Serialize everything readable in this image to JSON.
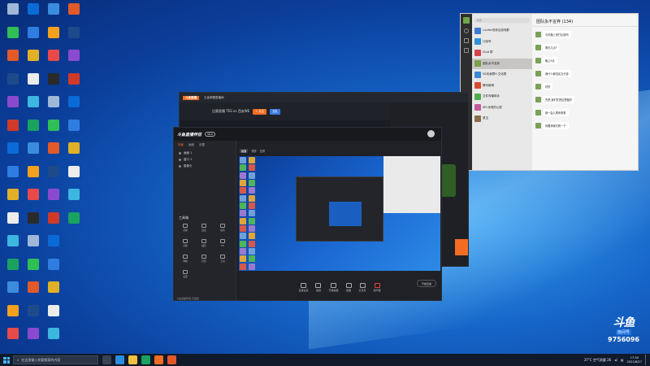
{
  "taskbar": {
    "search_placeholder": "在这里输入你要搜索的内容",
    "weather": "37°C 空气质量 26",
    "time": "17:30",
    "date": "2021/8/27"
  },
  "overlay": {
    "brand": "斗鱼",
    "room_label": "房间号",
    "room_number": "9756096"
  },
  "chat": {
    "title": "团队永不言弃 (134)",
    "search": "搜索",
    "contacts": [
      {
        "name": "Lucifer的综合游戏群",
        "color": "#3b7bd1"
      },
      {
        "name": "订阅号",
        "color": "#2f8fd8"
      },
      {
        "name": "Stud 群",
        "color": "#d5444a"
      },
      {
        "name": "团队永不言弃",
        "color": "#7b9f4a"
      },
      {
        "name": "N2玩家群5-文化群",
        "color": "#3d89d4"
      },
      {
        "name": "腾讯新闻",
        "color": "#d84a31"
      },
      {
        "name": "文件传输助手",
        "color": "#4fae4f"
      },
      {
        "name": "KPL永恒的心愿",
        "color": "#c45b9a"
      },
      {
        "name": "泉玉",
        "color": "#8a6d4c"
      }
    ],
    "messages": [
      "今天晚上来打比赛吗",
      "明天几点?",
      "晚上9点",
      "我什么都没买五分钟",
      "好的",
      "先把,我们先把这里做好",
      "我一会儿再来看看",
      "你要帮我们看一下"
    ]
  },
  "game_window": {
    "tabs": [
      "斗鱼直播",
      "王者荣耀直播间"
    ],
    "title": "比赛直播 TES vs 西安WE",
    "follow": "+ 关注",
    "gift_label": "送礼"
  },
  "stream_app": {
    "title": "斗鱼直播伴侣",
    "version": "V6.0",
    "scene_tabs": [
      "场景",
      "画面",
      "设置"
    ],
    "sources": [
      "画面 1",
      "窗口 1",
      "摄像头"
    ],
    "tools_title": "工具箱",
    "tools": [
      "录屏",
      "连麦",
      "投票",
      "竞猜",
      "抽奖",
      "PK",
      "弹幕",
      "红包",
      "工具",
      "设置"
    ],
    "preview_tabs": [
      "画面",
      "横屏",
      "竖屏"
    ],
    "bottom_buttons": [
      "直播设置",
      "美颜",
      "开播提醒",
      "截图",
      "麦克风",
      "扬声器"
    ],
    "go_live": "开始直播",
    "footer": "斗鱼直播伴侣 已连接"
  }
}
